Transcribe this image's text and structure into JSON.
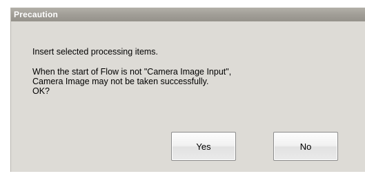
{
  "dialog": {
    "title": "Precaution",
    "message_lines": [
      "Insert selected processing items.",
      "When the start of Flow is not \"Camera Image Input\",",
      "Camera Image may not be taken successfully.",
      "OK?"
    ],
    "buttons": {
      "yes_label": "Yes",
      "no_label": "No"
    }
  },
  "colors": {
    "dialog_background": "#dddbd6",
    "title_bar": "#a19e97",
    "title_text": "#ffffff"
  }
}
